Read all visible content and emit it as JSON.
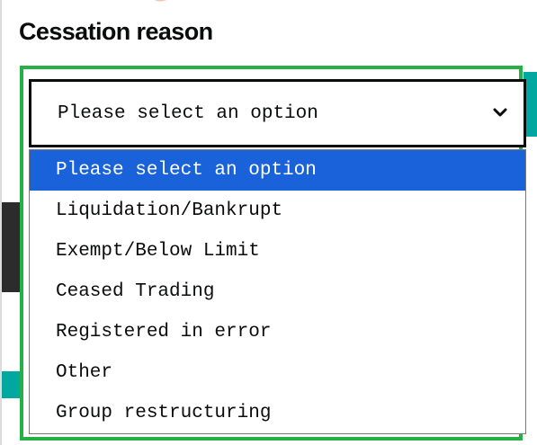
{
  "form": {
    "label": "Cessation reason"
  },
  "select": {
    "current_value": "Please select an option",
    "options": [
      {
        "label": "Please select an option",
        "selected": true
      },
      {
        "label": "Liquidation/Bankrupt",
        "selected": false
      },
      {
        "label": "Exempt/Below Limit",
        "selected": false
      },
      {
        "label": "Ceased Trading",
        "selected": false
      },
      {
        "label": "Registered in error",
        "selected": false
      },
      {
        "label": "Other",
        "selected": false
      },
      {
        "label": "Group restructuring",
        "selected": false
      }
    ]
  },
  "icons": {
    "dropdown": "chevron-down-icon"
  },
  "colors": {
    "highlight_border": "#27b045",
    "selected_option_bg": "#1a62d9",
    "text": "#0b0c0c",
    "accent_teal": "#00a8a0"
  }
}
